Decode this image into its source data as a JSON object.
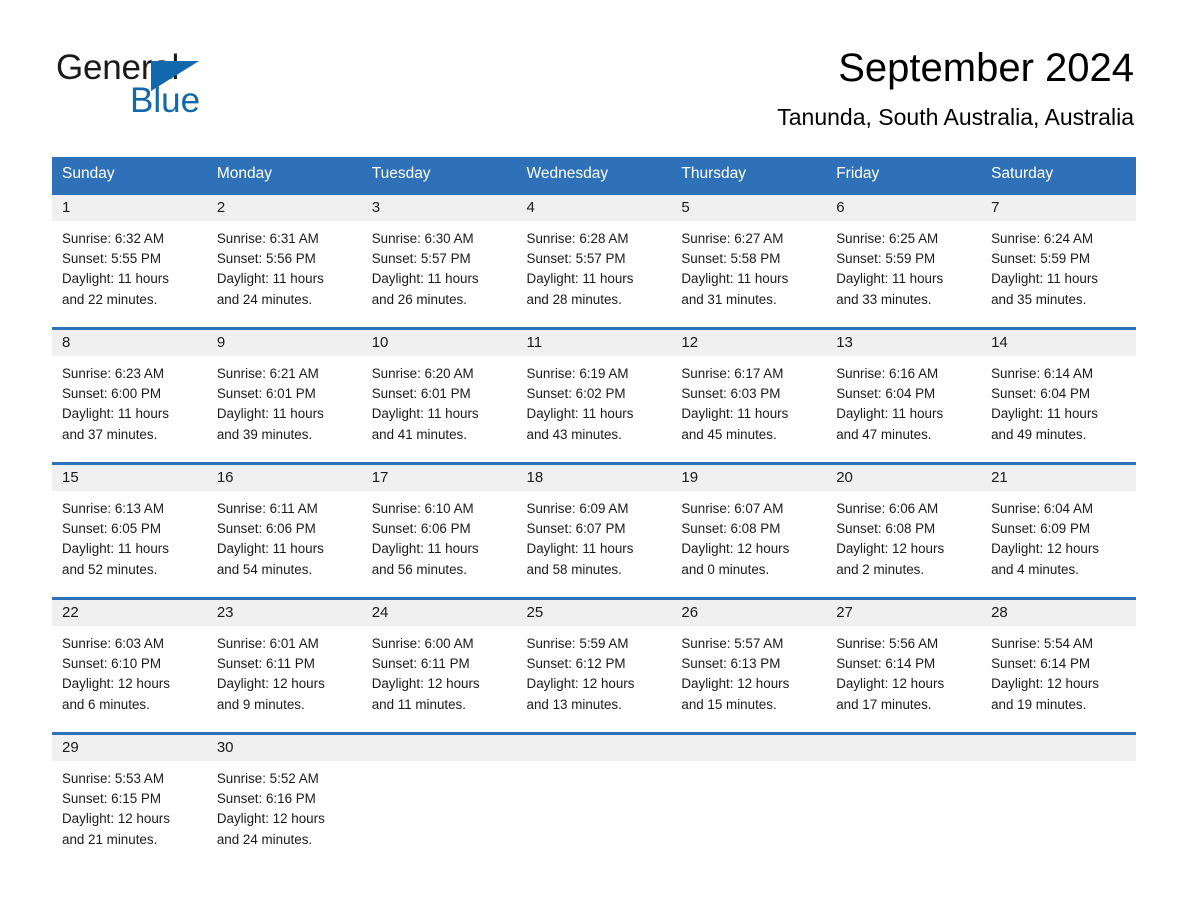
{
  "brand": {
    "name_dark": "General",
    "name_light": "Blue",
    "triangle_color": "#1168ac"
  },
  "header": {
    "title": "September 2024",
    "subtitle": "Tanunda, South Australia, Australia"
  },
  "theme": {
    "header_blue": "#2E71B8",
    "daynum_band": "#f0f0f0",
    "text": "#1a1a1a"
  },
  "weekday_headers": [
    "Sunday",
    "Monday",
    "Tuesday",
    "Wednesday",
    "Thursday",
    "Friday",
    "Saturday"
  ],
  "labels": {
    "sunrise_prefix": "Sunrise:",
    "sunset_prefix": "Sunset:",
    "daylight_prefix": "Daylight:"
  },
  "weeks": [
    [
      {
        "day": "1",
        "sunrise": "Sunrise: 6:32 AM",
        "sunset": "Sunset: 5:55 PM",
        "daylight_line1": "Daylight: 11 hours",
        "daylight_line2": "and 22 minutes."
      },
      {
        "day": "2",
        "sunrise": "Sunrise: 6:31 AM",
        "sunset": "Sunset: 5:56 PM",
        "daylight_line1": "Daylight: 11 hours",
        "daylight_line2": "and 24 minutes."
      },
      {
        "day": "3",
        "sunrise": "Sunrise: 6:30 AM",
        "sunset": "Sunset: 5:57 PM",
        "daylight_line1": "Daylight: 11 hours",
        "daylight_line2": "and 26 minutes."
      },
      {
        "day": "4",
        "sunrise": "Sunrise: 6:28 AM",
        "sunset": "Sunset: 5:57 PM",
        "daylight_line1": "Daylight: 11 hours",
        "daylight_line2": "and 28 minutes."
      },
      {
        "day": "5",
        "sunrise": "Sunrise: 6:27 AM",
        "sunset": "Sunset: 5:58 PM",
        "daylight_line1": "Daylight: 11 hours",
        "daylight_line2": "and 31 minutes."
      },
      {
        "day": "6",
        "sunrise": "Sunrise: 6:25 AM",
        "sunset": "Sunset: 5:59 PM",
        "daylight_line1": "Daylight: 11 hours",
        "daylight_line2": "and 33 minutes."
      },
      {
        "day": "7",
        "sunrise": "Sunrise: 6:24 AM",
        "sunset": "Sunset: 5:59 PM",
        "daylight_line1": "Daylight: 11 hours",
        "daylight_line2": "and 35 minutes."
      }
    ],
    [
      {
        "day": "8",
        "sunrise": "Sunrise: 6:23 AM",
        "sunset": "Sunset: 6:00 PM",
        "daylight_line1": "Daylight: 11 hours",
        "daylight_line2": "and 37 minutes."
      },
      {
        "day": "9",
        "sunrise": "Sunrise: 6:21 AM",
        "sunset": "Sunset: 6:01 PM",
        "daylight_line1": "Daylight: 11 hours",
        "daylight_line2": "and 39 minutes."
      },
      {
        "day": "10",
        "sunrise": "Sunrise: 6:20 AM",
        "sunset": "Sunset: 6:01 PM",
        "daylight_line1": "Daylight: 11 hours",
        "daylight_line2": "and 41 minutes."
      },
      {
        "day": "11",
        "sunrise": "Sunrise: 6:19 AM",
        "sunset": "Sunset: 6:02 PM",
        "daylight_line1": "Daylight: 11 hours",
        "daylight_line2": "and 43 minutes."
      },
      {
        "day": "12",
        "sunrise": "Sunrise: 6:17 AM",
        "sunset": "Sunset: 6:03 PM",
        "daylight_line1": "Daylight: 11 hours",
        "daylight_line2": "and 45 minutes."
      },
      {
        "day": "13",
        "sunrise": "Sunrise: 6:16 AM",
        "sunset": "Sunset: 6:04 PM",
        "daylight_line1": "Daylight: 11 hours",
        "daylight_line2": "and 47 minutes."
      },
      {
        "day": "14",
        "sunrise": "Sunrise: 6:14 AM",
        "sunset": "Sunset: 6:04 PM",
        "daylight_line1": "Daylight: 11 hours",
        "daylight_line2": "and 49 minutes."
      }
    ],
    [
      {
        "day": "15",
        "sunrise": "Sunrise: 6:13 AM",
        "sunset": "Sunset: 6:05 PM",
        "daylight_line1": "Daylight: 11 hours",
        "daylight_line2": "and 52 minutes."
      },
      {
        "day": "16",
        "sunrise": "Sunrise: 6:11 AM",
        "sunset": "Sunset: 6:06 PM",
        "daylight_line1": "Daylight: 11 hours",
        "daylight_line2": "and 54 minutes."
      },
      {
        "day": "17",
        "sunrise": "Sunrise: 6:10 AM",
        "sunset": "Sunset: 6:06 PM",
        "daylight_line1": "Daylight: 11 hours",
        "daylight_line2": "and 56 minutes."
      },
      {
        "day": "18",
        "sunrise": "Sunrise: 6:09 AM",
        "sunset": "Sunset: 6:07 PM",
        "daylight_line1": "Daylight: 11 hours",
        "daylight_line2": "and 58 minutes."
      },
      {
        "day": "19",
        "sunrise": "Sunrise: 6:07 AM",
        "sunset": "Sunset: 6:08 PM",
        "daylight_line1": "Daylight: 12 hours",
        "daylight_line2": "and 0 minutes."
      },
      {
        "day": "20",
        "sunrise": "Sunrise: 6:06 AM",
        "sunset": "Sunset: 6:08 PM",
        "daylight_line1": "Daylight: 12 hours",
        "daylight_line2": "and 2 minutes."
      },
      {
        "day": "21",
        "sunrise": "Sunrise: 6:04 AM",
        "sunset": "Sunset: 6:09 PM",
        "daylight_line1": "Daylight: 12 hours",
        "daylight_line2": "and 4 minutes."
      }
    ],
    [
      {
        "day": "22",
        "sunrise": "Sunrise: 6:03 AM",
        "sunset": "Sunset: 6:10 PM",
        "daylight_line1": "Daylight: 12 hours",
        "daylight_line2": "and 6 minutes."
      },
      {
        "day": "23",
        "sunrise": "Sunrise: 6:01 AM",
        "sunset": "Sunset: 6:11 PM",
        "daylight_line1": "Daylight: 12 hours",
        "daylight_line2": "and 9 minutes."
      },
      {
        "day": "24",
        "sunrise": "Sunrise: 6:00 AM",
        "sunset": "Sunset: 6:11 PM",
        "daylight_line1": "Daylight: 12 hours",
        "daylight_line2": "and 11 minutes."
      },
      {
        "day": "25",
        "sunrise": "Sunrise: 5:59 AM",
        "sunset": "Sunset: 6:12 PM",
        "daylight_line1": "Daylight: 12 hours",
        "daylight_line2": "and 13 minutes."
      },
      {
        "day": "26",
        "sunrise": "Sunrise: 5:57 AM",
        "sunset": "Sunset: 6:13 PM",
        "daylight_line1": "Daylight: 12 hours",
        "daylight_line2": "and 15 minutes."
      },
      {
        "day": "27",
        "sunrise": "Sunrise: 5:56 AM",
        "sunset": "Sunset: 6:14 PM",
        "daylight_line1": "Daylight: 12 hours",
        "daylight_line2": "and 17 minutes."
      },
      {
        "day": "28",
        "sunrise": "Sunrise: 5:54 AM",
        "sunset": "Sunset: 6:14 PM",
        "daylight_line1": "Daylight: 12 hours",
        "daylight_line2": "and 19 minutes."
      }
    ],
    [
      {
        "day": "29",
        "sunrise": "Sunrise: 5:53 AM",
        "sunset": "Sunset: 6:15 PM",
        "daylight_line1": "Daylight: 12 hours",
        "daylight_line2": "and 21 minutes."
      },
      {
        "day": "30",
        "sunrise": "Sunrise: 5:52 AM",
        "sunset": "Sunset: 6:16 PM",
        "daylight_line1": "Daylight: 12 hours",
        "daylight_line2": "and 24 minutes."
      },
      {
        "day": "",
        "sunrise": "",
        "sunset": "",
        "daylight_line1": "",
        "daylight_line2": ""
      },
      {
        "day": "",
        "sunrise": "",
        "sunset": "",
        "daylight_line1": "",
        "daylight_line2": ""
      },
      {
        "day": "",
        "sunrise": "",
        "sunset": "",
        "daylight_line1": "",
        "daylight_line2": ""
      },
      {
        "day": "",
        "sunrise": "",
        "sunset": "",
        "daylight_line1": "",
        "daylight_line2": ""
      },
      {
        "day": "",
        "sunrise": "",
        "sunset": "",
        "daylight_line1": "",
        "daylight_line2": ""
      }
    ]
  ]
}
